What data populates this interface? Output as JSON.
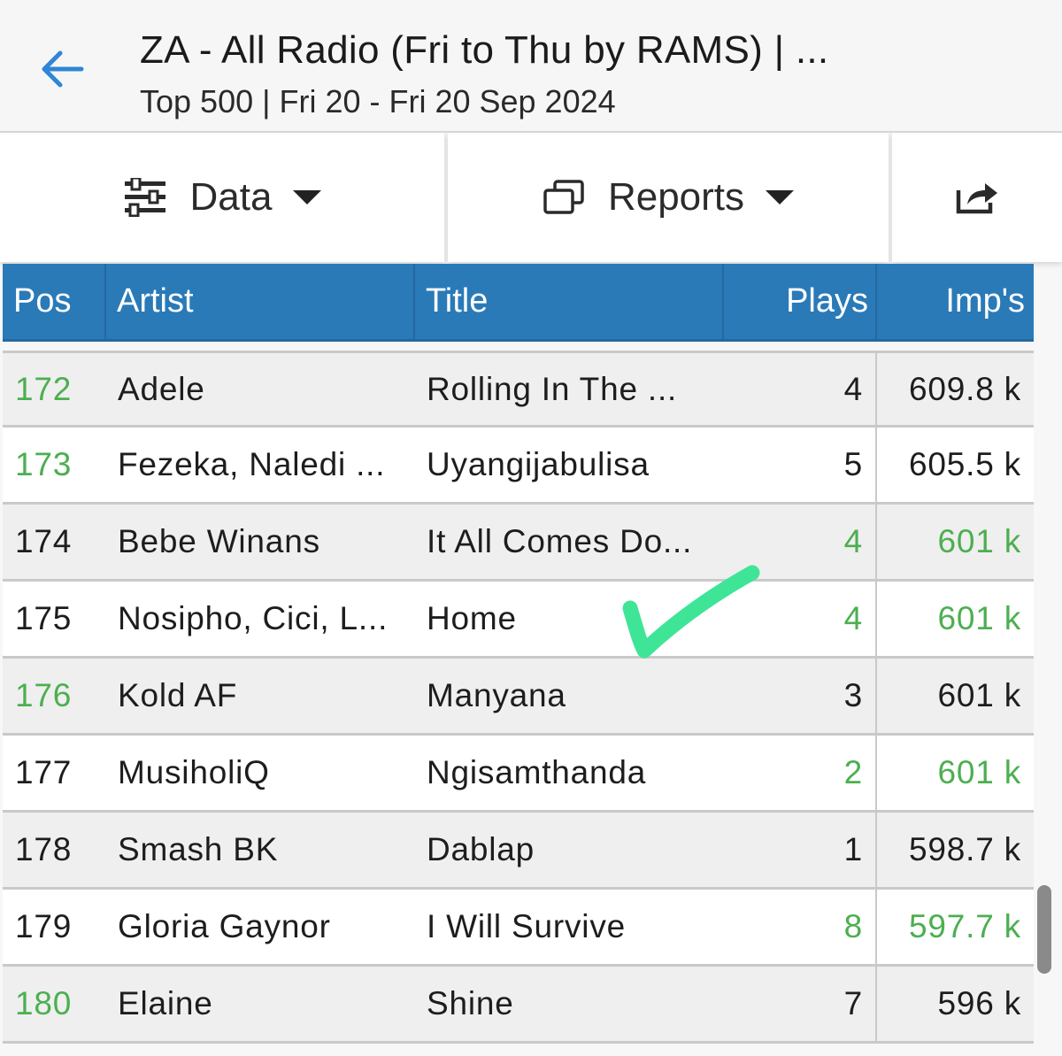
{
  "header": {
    "title": "ZA - All Radio (Fri to Thu by RAMS) | ...",
    "subtitle": "Top 500 | Fri 20 - Fri 20 Sep 2024",
    "back_icon": "arrow-left-icon"
  },
  "toolbar": {
    "data_label": "Data",
    "reports_label": "Reports",
    "icons": [
      "sliders-icon",
      "windows-icon",
      "share-icon",
      "caret-down-icon"
    ]
  },
  "colors": {
    "header_bg": "#f6f6f6",
    "table_header_bg": "#2a7ab8",
    "highlight_green": "#4caf50",
    "back_arrow": "#2f86d6",
    "annotation_check": "#3ee596"
  },
  "table": {
    "columns": [
      "Pos",
      "Artist",
      "Title",
      "Plays",
      "Imp's"
    ],
    "rows": [
      {
        "pos": "172",
        "artist": "Adele",
        "title": "Rolling In The ...",
        "plays": "4",
        "imps": "609.8 k",
        "pos_green": true,
        "plays_green": false,
        "imps_green": false
      },
      {
        "pos": "173",
        "artist": "Fezeka, Naledi ...",
        "title": "Uyangijabulisa",
        "plays": "5",
        "imps": "605.5 k",
        "pos_green": true,
        "plays_green": false,
        "imps_green": false
      },
      {
        "pos": "174",
        "artist": "Bebe Winans",
        "title": "It All Comes Do...",
        "plays": "4",
        "imps": "601 k",
        "pos_green": false,
        "plays_green": true,
        "imps_green": true
      },
      {
        "pos": "175",
        "artist": "Nosipho, Cici, L...",
        "title": "Home",
        "plays": "4",
        "imps": "601 k",
        "pos_green": false,
        "plays_green": true,
        "imps_green": true
      },
      {
        "pos": "176",
        "artist": "Kold AF",
        "title": "Manyana",
        "plays": "3",
        "imps": "601 k",
        "pos_green": true,
        "plays_green": false,
        "imps_green": false
      },
      {
        "pos": "177",
        "artist": "MusiholiQ",
        "title": "Ngisamthanda",
        "plays": "2",
        "imps": "601 k",
        "pos_green": false,
        "plays_green": true,
        "imps_green": true
      },
      {
        "pos": "178",
        "artist": "Smash BK",
        "title": "Dablap",
        "plays": "1",
        "imps": "598.7 k",
        "pos_green": false,
        "plays_green": false,
        "imps_green": false
      },
      {
        "pos": "179",
        "artist": "Gloria Gaynor",
        "title": "I Will Survive",
        "plays": "8",
        "imps": "597.7 k",
        "pos_green": false,
        "plays_green": true,
        "imps_green": true
      },
      {
        "pos": "180",
        "artist": "Elaine",
        "title": "Shine",
        "plays": "7",
        "imps": "596 k",
        "pos_green": true,
        "plays_green": false,
        "imps_green": false
      }
    ]
  },
  "annotation": {
    "icon": "checkmark-icon"
  }
}
